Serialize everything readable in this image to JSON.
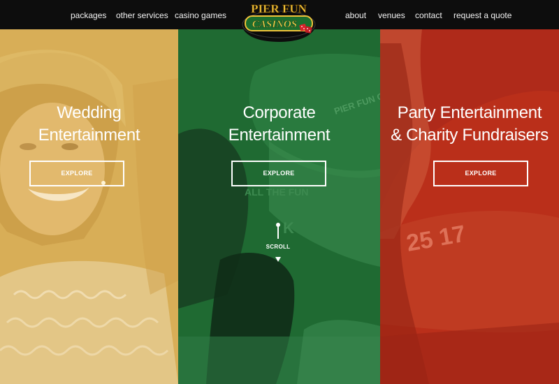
{
  "nav": {
    "left": [
      "packages",
      "other services",
      "casino games"
    ],
    "right": [
      "about",
      "venues",
      "contact",
      "request a quote"
    ]
  },
  "logo": {
    "line1": "PIER FUN",
    "line2": "CASINOS"
  },
  "panels": [
    {
      "title_line1": "Wedding",
      "title_line2": "Entertainment",
      "button": "EXPLORE",
      "tint": "#d6ad55"
    },
    {
      "title_line1": "Corporate",
      "title_line2": "Entertainment",
      "button": "EXPLORE",
      "tint": "#1f6a32"
    },
    {
      "title_line1": "Party Entertainment",
      "title_line2": "& Charity Fundraisers",
      "button": "EXPLORE",
      "tint": "#ba2f1a"
    }
  ],
  "scroll": {
    "label": "SCROLL"
  },
  "background_text": {
    "mid_logo": "PIER FUN CASINOS",
    "mid_shirt": "ALL THE FUN",
    "mid_shirt_word": "K",
    "right_numbers": "25 17"
  }
}
